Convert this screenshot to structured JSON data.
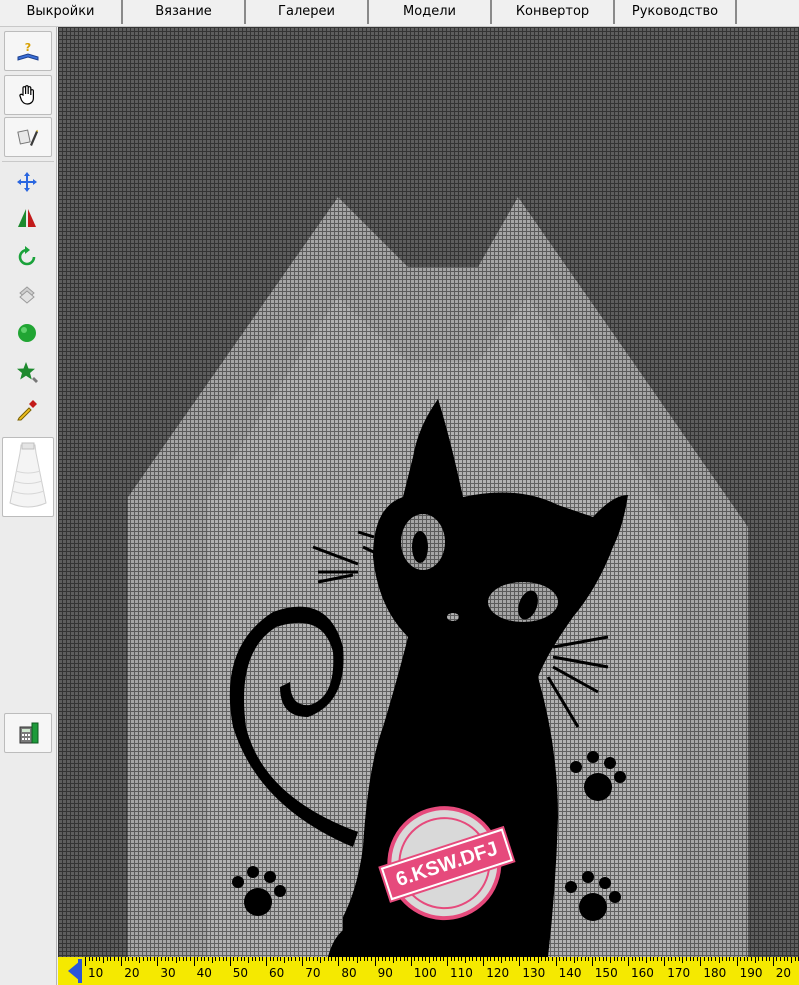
{
  "menu": {
    "items": [
      {
        "label": "Выкройки"
      },
      {
        "label": "Вязание"
      },
      {
        "label": "Галереи"
      },
      {
        "label": "Модели"
      },
      {
        "label": "Конвертор"
      },
      {
        "label": "Руководство"
      }
    ]
  },
  "toolbar": {
    "tools": [
      {
        "name": "help-book-icon"
      },
      {
        "name": "hand-pan-icon"
      },
      {
        "name": "eraser-pencil-icon"
      },
      {
        "name": "move-arrows-icon"
      },
      {
        "name": "mirror-triangle-icon"
      },
      {
        "name": "rotate-icon"
      },
      {
        "name": "layers-icon"
      },
      {
        "name": "fill-circle-icon"
      },
      {
        "name": "star-select-icon"
      },
      {
        "name": "color-picker-icon"
      },
      {
        "name": "yarn-cone-icon"
      },
      {
        "name": "calculator-icon"
      }
    ]
  },
  "ruler": {
    "labels": [
      "10",
      "20",
      "30",
      "40",
      "50",
      "60",
      "70",
      "80",
      "90",
      "100",
      "110",
      "120",
      "130",
      "140",
      "150",
      "160",
      "170",
      "180",
      "190",
      "20"
    ]
  },
  "stamp": {
    "text": "6.KSW.DFJ",
    "ring_text": "checked"
  },
  "colors": {
    "ruler": "#f5e900",
    "grid_dark": "#4d4d4d",
    "grid_light": "#9a9a9a",
    "cat": "#000000",
    "stamp": "#e64a7c"
  }
}
